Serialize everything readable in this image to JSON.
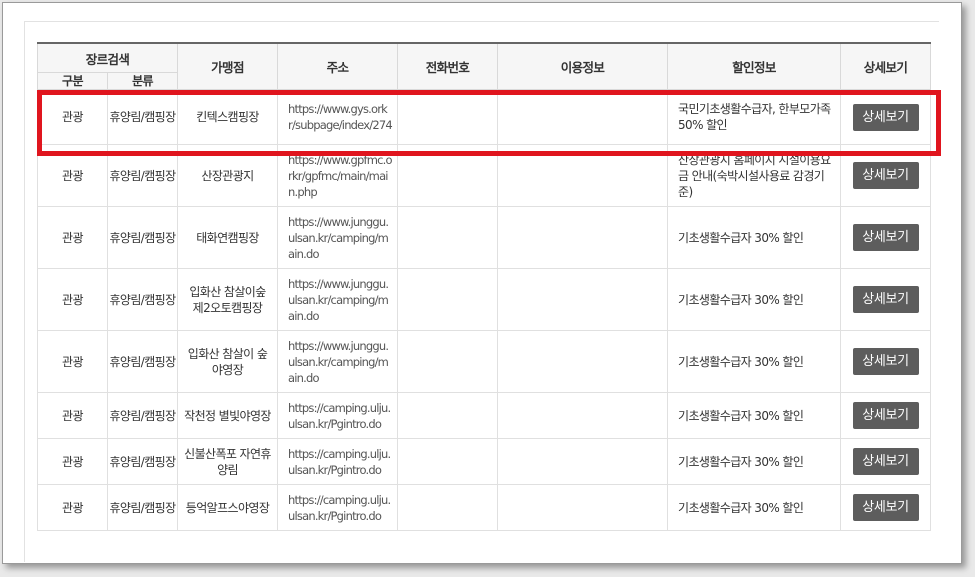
{
  "table": {
    "header": {
      "category_search": "장르검색",
      "gubun": "구분",
      "bunryu": "분류",
      "store": "가맹점",
      "address": "주소",
      "phone": "전화번호",
      "usage": "이용정보",
      "discount": "할인정보",
      "detail": "상세보기"
    },
    "rows": [
      {
        "gubun": "관광",
        "bunryu": "휴양림/캠핑장",
        "store": "킨텍스캠핑장",
        "address": "https://www.gys.orkr/subpage/index/274",
        "phone": "",
        "usage": "",
        "discount": "국민기초생활수급자, 한부모가족 50% 할인",
        "button": "상세보기"
      },
      {
        "gubun": "관광",
        "bunryu": "휴양림/캠핑장",
        "store": "산장관광지",
        "address": "https://www.gpfmc.orkr/gpfmc/main/main.php",
        "phone": "",
        "usage": "",
        "discount": "산장관광지 홈페이지 시설이용요금 안내(숙박시설사용료 감경기준)",
        "button": "상세보기"
      },
      {
        "gubun": "관광",
        "bunryu": "휴양림/캠핑장",
        "store": "태화연캠핑장",
        "address": "https://www.junggu.ulsan.kr/camping/main.do",
        "phone": "",
        "usage": "",
        "discount": "기초생활수급자 30% 할인",
        "button": "상세보기"
      },
      {
        "gubun": "관광",
        "bunryu": "휴양림/캠핑장",
        "store": "입화산 참살이숲 제2오토캠핑장",
        "address": "https://www.junggu.ulsan.kr/camping/main.do",
        "phone": "",
        "usage": "",
        "discount": "기초생활수급자 30% 할인",
        "button": "상세보기"
      },
      {
        "gubun": "관광",
        "bunryu": "휴양림/캠핑장",
        "store": "입화산 참살이 숲 야영장",
        "address": "https://www.junggu.ulsan.kr/camping/main.do",
        "phone": "",
        "usage": "",
        "discount": "기초생활수급자 30% 할인",
        "button": "상세보기"
      },
      {
        "gubun": "관광",
        "bunryu": "휴양림/캠핑장",
        "store": "작천정 별빛야영장",
        "address": "https://camping.ulju.ulsan.kr/Pgintro.do",
        "phone": "",
        "usage": "",
        "discount": "기초생활수급자 30% 할인",
        "button": "상세보기"
      },
      {
        "gubun": "관광",
        "bunryu": "휴양림/캠핑장",
        "store": "신불산폭포 자연휴양림",
        "address": "https://camping.ulju.ulsan.kr/Pgintro.do",
        "phone": "",
        "usage": "",
        "discount": "기초생활수급자 30% 할인",
        "button": "상세보기"
      },
      {
        "gubun": "관광",
        "bunryu": "휴양림/캠핑장",
        "store": "등억알프스야영장",
        "address": "https://camping.ulju.ulsan.kr/Pgintro.do",
        "phone": "",
        "usage": "",
        "discount": "기초생활수급자 30% 할인",
        "button": "상세보기"
      }
    ]
  },
  "colors": {
    "highlight": "#e0151e",
    "button_bg": "#5d5d5d"
  }
}
